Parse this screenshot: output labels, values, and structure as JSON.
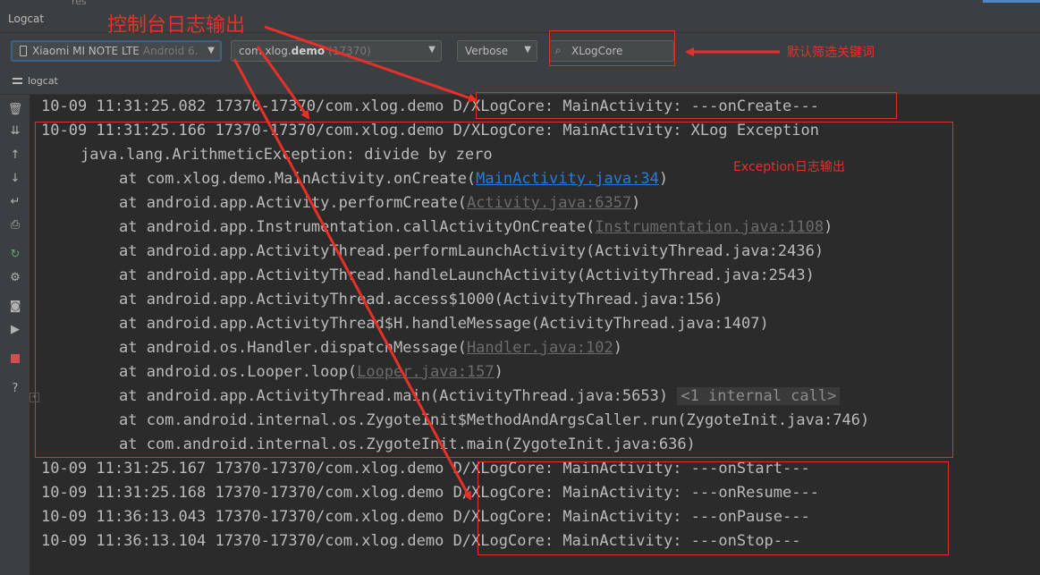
{
  "window": {
    "tree_label": "res",
    "panel_title": "Logcat"
  },
  "toolbar": {
    "device": "Xiaomi MI NOTE LTE",
    "device_os": "Android 6.",
    "process_prefix": "com.xlog.",
    "process_bold": "demo",
    "process_pid": "(17370)",
    "level": "Verbose",
    "search_value": "XLogCore"
  },
  "tab": {
    "label": "logcat"
  },
  "icons": [
    "trash-icon",
    "scroll-to-end-icon",
    "up-icon",
    "down-icon",
    "soft-wrap-icon",
    "print-icon",
    "restart-icon",
    "settings-icon",
    "screenshot-icon",
    "screen-record-icon",
    "stop-icon",
    "help-icon"
  ],
  "log": {
    "lines": [
      "10-09 11:31:25.082 17370-17370/com.xlog.demo D/XLogCore: MainActivity: ---onCreate---",
      "10-09 11:31:25.166 17370-17370/com.xlog.demo D/XLogCore: MainActivity: XLog Exception",
      "java.lang.ArithmeticException: divide by zero",
      "at com.xlog.demo.MainActivity.onCreate(",
      "MainActivity.java:34",
      ")",
      "at android.app.Activity.performCreate(",
      "Activity.java:6357",
      ")",
      "at android.app.Instrumentation.callActivityOnCreate(",
      "Instrumentation.java:1108",
      ")",
      "at android.app.ActivityThread.performLaunchActivity(ActivityThread.java:2436)",
      "at android.app.ActivityThread.handleLaunchActivity(ActivityThread.java:2543)",
      "at android.app.ActivityThread.access$1000(ActivityThread.java:156)",
      "at android.app.ActivityThread$H.handleMessage(ActivityThread.java:1407)",
      "at android.os.Handler.dispatchMessage(",
      "Handler.java:102",
      ")",
      "at android.os.Looper.loop(",
      "Looper.java:157",
      ")",
      "at android.app.ActivityThread.main(ActivityThread.java:5653)",
      "<1 internal call>",
      "at com.android.internal.os.ZygoteInit$MethodAndArgsCaller.run(ZygoteInit.java:746)",
      "at com.android.internal.os.ZygoteInit.main(ZygoteInit.java:636)",
      "10-09 11:31:25.167 17370-17370/com.xlog.demo D/XLogCore: MainActivity: ---onStart---",
      "10-09 11:31:25.168 17370-17370/com.xlog.demo D/XLogCore: MainActivity: ---onResume---",
      "10-09 11:36:13.043 17370-17370/com.xlog.demo D/XLogCore: MainActivity: ---onPause---",
      "10-09 11:36:13.104 17370-17370/com.xlog.demo D/XLogCore: MainActivity: ---onStop---"
    ]
  },
  "annotations": {
    "title": "控制台日志输出",
    "filter_note": "默认筛选关键词",
    "exception_note": "Exception日志输出",
    "color": "#e8302a"
  }
}
